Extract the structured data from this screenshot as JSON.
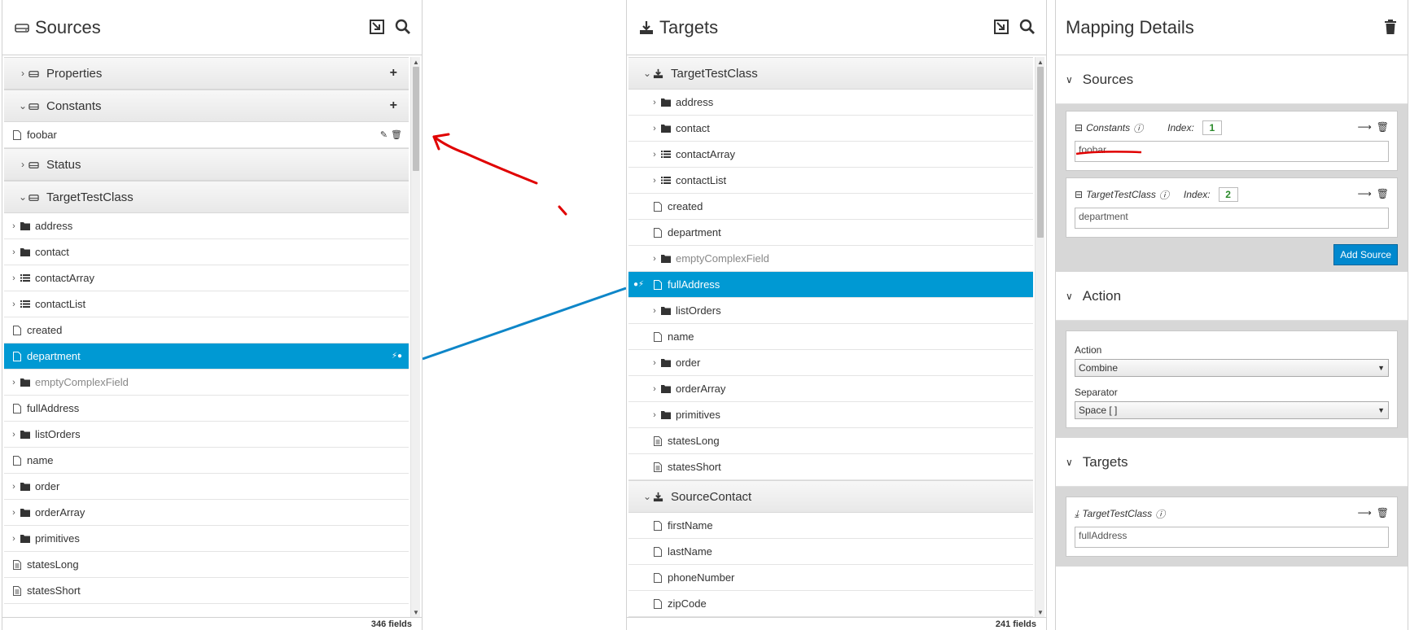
{
  "sources": {
    "title": "Sources",
    "footer": "346 fields",
    "items": [
      {
        "kind": "doc",
        "label": "Properties",
        "expanded": false,
        "icon": "hdd-icon",
        "plus": true
      },
      {
        "kind": "doc",
        "label": "Constants",
        "expanded": true,
        "icon": "hdd-icon",
        "plus": true
      },
      {
        "kind": "field",
        "label": "foobar",
        "icon": "file-icon",
        "indent": 0,
        "actions": [
          "edit-icon",
          "trash-icon"
        ]
      },
      {
        "kind": "doc",
        "label": "Status",
        "expanded": false,
        "icon": "hdd-icon"
      },
      {
        "kind": "doc",
        "label": "TargetTestClass",
        "expanded": true,
        "icon": "hdd-icon"
      },
      {
        "kind": "field",
        "label": "address",
        "icon": "folder-icon",
        "chev": true
      },
      {
        "kind": "field",
        "label": "contact",
        "icon": "folder-icon",
        "chev": true
      },
      {
        "kind": "field",
        "label": "contactArray",
        "icon": "list-icon",
        "chev": true
      },
      {
        "kind": "field",
        "label": "contactList",
        "icon": "list-icon",
        "chev": true
      },
      {
        "kind": "field",
        "label": "created",
        "icon": "file-icon"
      },
      {
        "kind": "field",
        "label": "department",
        "icon": "file-icon",
        "selected": true
      },
      {
        "kind": "field",
        "label": "emptyComplexField",
        "icon": "folder-icon",
        "chev": true,
        "muted": true
      },
      {
        "kind": "field",
        "label": "fullAddress",
        "icon": "file-icon"
      },
      {
        "kind": "field",
        "label": "listOrders",
        "icon": "folder-icon",
        "chev": true
      },
      {
        "kind": "field",
        "label": "name",
        "icon": "file-icon"
      },
      {
        "kind": "field",
        "label": "order",
        "icon": "folder-icon",
        "chev": true
      },
      {
        "kind": "field",
        "label": "orderArray",
        "icon": "folder-icon",
        "chev": true
      },
      {
        "kind": "field",
        "label": "primitives",
        "icon": "folder-icon",
        "chev": true
      },
      {
        "kind": "field",
        "label": "statesLong",
        "icon": "file-text-icon"
      },
      {
        "kind": "field",
        "label": "statesShort",
        "icon": "file-text-icon"
      }
    ]
  },
  "targets": {
    "title": "Targets",
    "footer": "241 fields",
    "items": [
      {
        "kind": "doc",
        "label": "TargetTestClass",
        "expanded": true,
        "icon": "download-icon"
      },
      {
        "kind": "field",
        "label": "address",
        "icon": "folder-icon",
        "chev": true
      },
      {
        "kind": "field",
        "label": "contact",
        "icon": "folder-icon",
        "chev": true
      },
      {
        "kind": "field",
        "label": "contactArray",
        "icon": "list-icon",
        "chev": true
      },
      {
        "kind": "field",
        "label": "contactList",
        "icon": "list-icon",
        "chev": true
      },
      {
        "kind": "field",
        "label": "created",
        "icon": "file-icon"
      },
      {
        "kind": "field",
        "label": "department",
        "icon": "file-icon"
      },
      {
        "kind": "field",
        "label": "emptyComplexField",
        "icon": "folder-icon",
        "chev": true,
        "muted": true
      },
      {
        "kind": "field",
        "label": "fullAddress",
        "icon": "file-icon",
        "selected": true
      },
      {
        "kind": "field",
        "label": "listOrders",
        "icon": "folder-icon",
        "chev": true
      },
      {
        "kind": "field",
        "label": "name",
        "icon": "file-icon"
      },
      {
        "kind": "field",
        "label": "order",
        "icon": "folder-icon",
        "chev": true
      },
      {
        "kind": "field",
        "label": "orderArray",
        "icon": "folder-icon",
        "chev": true
      },
      {
        "kind": "field",
        "label": "primitives",
        "icon": "folder-icon",
        "chev": true
      },
      {
        "kind": "field",
        "label": "statesLong",
        "icon": "file-text-icon"
      },
      {
        "kind": "field",
        "label": "statesShort",
        "icon": "file-text-icon"
      },
      {
        "kind": "doc",
        "label": "SourceContact",
        "expanded": true,
        "icon": "download-icon"
      },
      {
        "kind": "field",
        "label": "firstName",
        "icon": "file-icon"
      },
      {
        "kind": "field",
        "label": "lastName",
        "icon": "file-icon"
      },
      {
        "kind": "field",
        "label": "phoneNumber",
        "icon": "file-icon"
      },
      {
        "kind": "field",
        "label": "zipCode",
        "icon": "file-icon"
      }
    ]
  },
  "details": {
    "title": "Mapping Details",
    "sources_section": "Sources",
    "source_cards": [
      {
        "doc": "Constants",
        "index_label": "Index:",
        "index": "1",
        "value": "foobar"
      },
      {
        "doc": "TargetTestClass",
        "index_label": "Index:",
        "index": "2",
        "value": "department"
      }
    ],
    "add_source": "Add Source",
    "action_section": "Action",
    "action_label": "Action",
    "action_value": "Combine",
    "separator_label": "Separator",
    "separator_value": "Space [ ]",
    "targets_section": "Targets",
    "target_card": {
      "doc": "TargetTestClass",
      "value": "fullAddress"
    }
  },
  "colors": {
    "selected": "#0099d3",
    "mapping_line": "#0e86c8",
    "annotation": "#e00000",
    "index_text": "#2a8a2a"
  }
}
